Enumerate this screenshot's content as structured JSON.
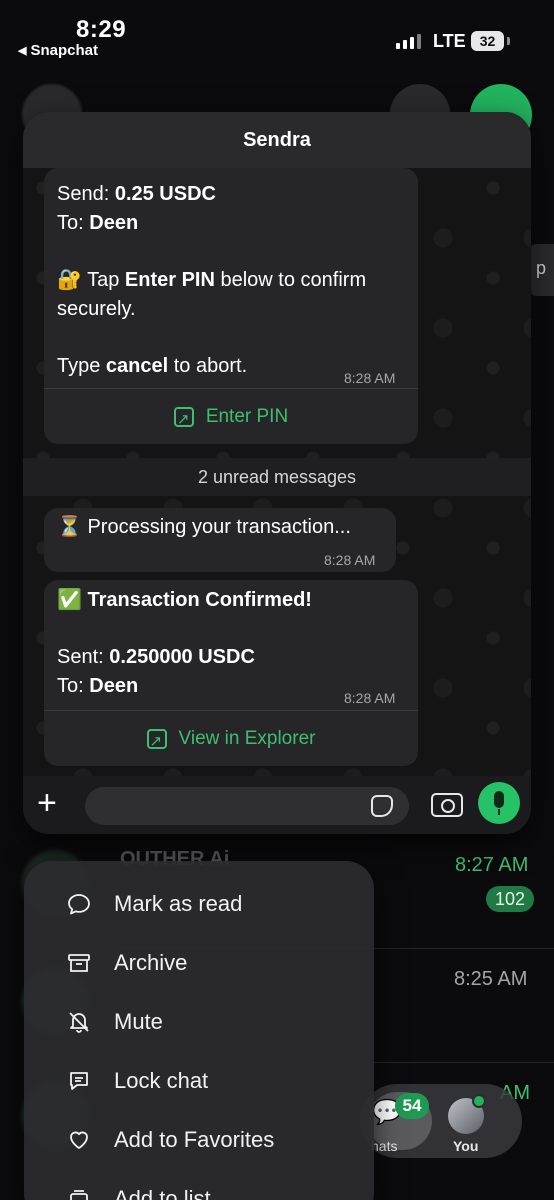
{
  "status_bar": {
    "time": "8:29",
    "back_app": "Snapchat",
    "network": "LTE",
    "battery": "32"
  },
  "chat_preview": {
    "title": "Sendra",
    "message1": {
      "send_label": "Send: ",
      "send_value": "0.25 USDC",
      "to_label": "To: ",
      "to_value": "Deen",
      "lock_emoji": "🔐",
      "tap_prefix": " Tap ",
      "tap_bold": "Enter PIN",
      "tap_suffix": " below to confirm securely.",
      "type_prefix": "Type ",
      "type_bold": "cancel",
      "type_suffix": " to abort.",
      "time": "8:28 AM",
      "action_label": "Enter PIN"
    },
    "unread_label": "2 unread messages",
    "message2": {
      "emoji": "⏳",
      "text": " Processing your transaction...",
      "time": "8:28 AM"
    },
    "message3": {
      "emoji": "✅",
      "title": "Transaction Confirmed!",
      "sent_label": "Sent: ",
      "sent_value": "0.250000 USDC",
      "to_label": "To: ",
      "to_value": "Deen",
      "time": "8:28 AM",
      "action_label": "View in Explorer"
    }
  },
  "background_list": {
    "row1_name": "OUTHER Ai",
    "row1_time": "8:27 AM",
    "row1_badge": "102",
    "row2_time": "8:25 AM",
    "row3_time": "AM"
  },
  "tab_bar": {
    "chats_label": "hats",
    "chats_badge": "54",
    "you_label": "You"
  },
  "context_menu": {
    "items": [
      {
        "label": "Mark as read",
        "icon": "chat-bubble-icon"
      },
      {
        "label": "Archive",
        "icon": "archive-icon"
      },
      {
        "label": "Mute",
        "icon": "bell-off-icon"
      },
      {
        "label": "Lock chat",
        "icon": "lock-chat-icon"
      },
      {
        "label": "Add to Favorites",
        "icon": "heart-icon"
      },
      {
        "label": "Add to list",
        "icon": "list-icon"
      }
    ]
  },
  "colors": {
    "accent_green": "#25c267",
    "link_green": "#3fbf6d",
    "bubble": "#262628",
    "background": "#0b0b0d"
  }
}
